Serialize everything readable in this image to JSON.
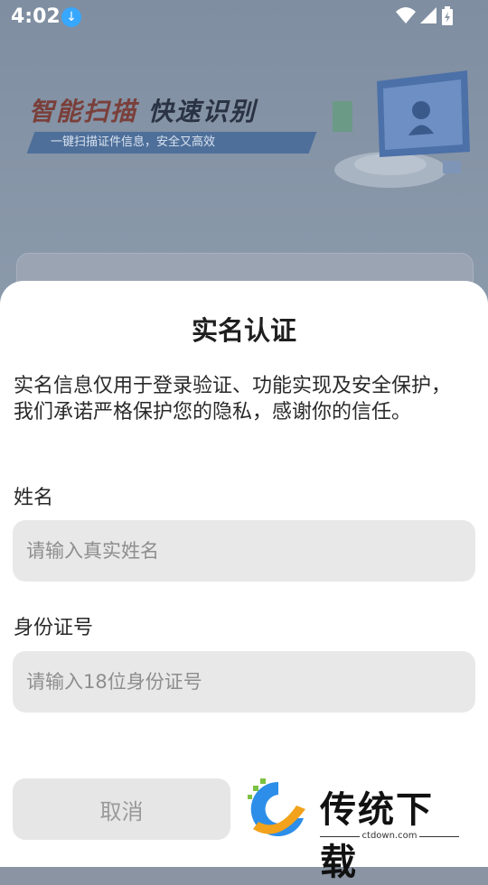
{
  "status_bar": {
    "time": "4:02",
    "icons": [
      "download-icon",
      "wifi-icon",
      "signal-icon",
      "battery-icon"
    ]
  },
  "banner": {
    "title_part1": "智能扫描",
    "title_part2": "快速识别",
    "subtitle": "一键扫描证件信息，安全又高效"
  },
  "dialog": {
    "title": "实名认证",
    "description": "实名信息仅用于登录验证、功能实现及安全保护，我们承诺严格保护您的隐私，感谢你的信任。",
    "name_label": "姓名",
    "name_placeholder": "请输入真实姓名",
    "name_value": "",
    "id_label": "身份证号",
    "id_placeholder": "请输入18位身份证号",
    "id_value": "",
    "cancel_label": "取消"
  },
  "watermark": {
    "text": "传统下载",
    "domain": "ctdown.com"
  },
  "colors": {
    "overlay_bg": "#8a94a3",
    "sheet_bg": "#ffffff",
    "input_bg": "#e8e8e8",
    "banner_accent": "#4e6f9a"
  }
}
